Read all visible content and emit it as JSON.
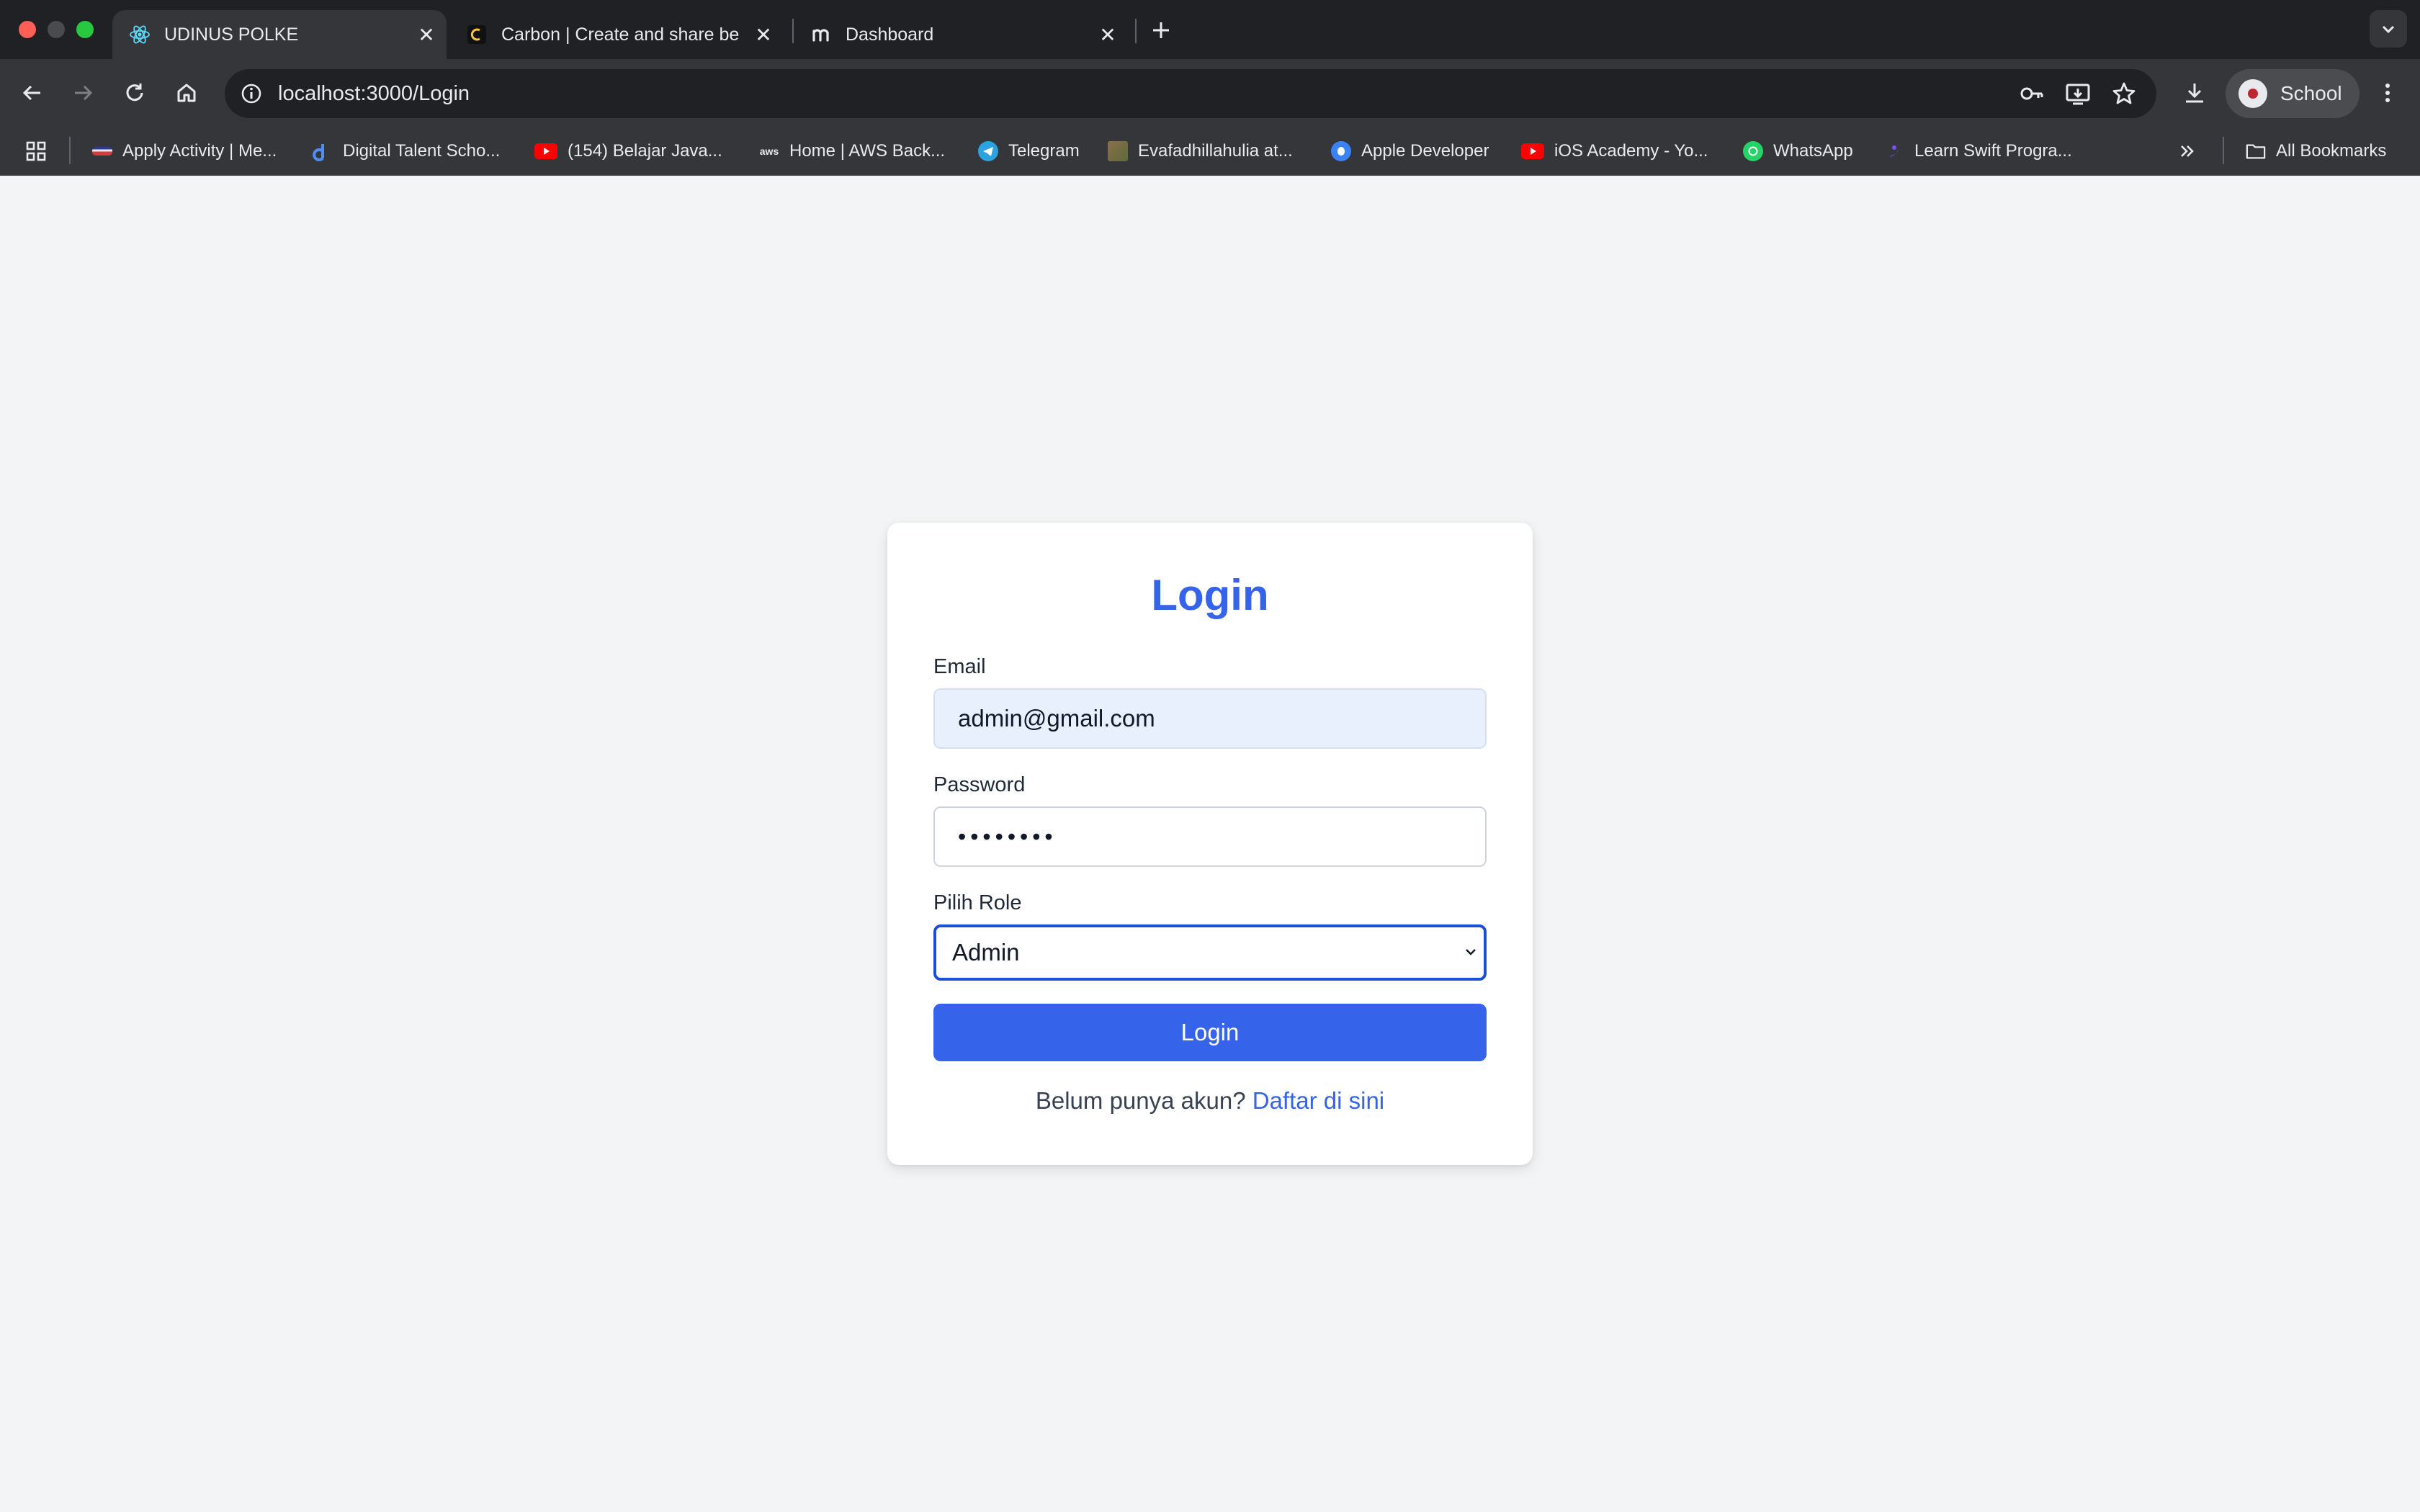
{
  "browser": {
    "tabs": [
      {
        "title": "UDINUS POLKE",
        "favicon": "react-icon",
        "active": true
      },
      {
        "title": "Carbon | Create and share be",
        "favicon": "carbon-icon",
        "active": false
      },
      {
        "title": "Dashboard",
        "favicon": "m-logo-icon",
        "active": false
      }
    ],
    "url": "localhost:3000/Login",
    "profile_name": "School",
    "bookmarks": [
      {
        "label": "Apply Activity | Me...",
        "icon": "kampus-merdeka-icon"
      },
      {
        "label": "Digital Talent Scho...",
        "icon": "dts-icon"
      },
      {
        "label": "(154) Belajar Java...",
        "icon": "youtube-icon"
      },
      {
        "label": "Home | AWS Back...",
        "icon": "aws-icon"
      },
      {
        "label": "Telegram",
        "icon": "telegram-icon"
      },
      {
        "label": "Evafadhillahulia at...",
        "icon": "photo-icon"
      },
      {
        "label": "Apple Developer",
        "icon": "apple-icon"
      },
      {
        "label": "iOS Academy - Yo...",
        "icon": "youtube-icon"
      },
      {
        "label": "WhatsApp",
        "icon": "whatsapp-icon"
      },
      {
        "label": "Learn Swift Progra...",
        "icon": "swift-icon"
      }
    ],
    "all_bookmarks_label": "All Bookmarks",
    "colors": {
      "chrome": "#35363a",
      "tabstrip": "#202124"
    }
  },
  "login": {
    "title": "Login",
    "email_label": "Email",
    "email_value": "admin@gmail.com",
    "password_label": "Password",
    "password_value": "••••••••",
    "role_label": "Pilih Role",
    "role_selected": "Admin",
    "submit_label": "Login",
    "signup_prompt": "Belum punya akun?",
    "signup_link": "Daftar di sini",
    "colors": {
      "accent": "#3563e9",
      "background": "#f3f4f6",
      "card": "#ffffff"
    }
  }
}
